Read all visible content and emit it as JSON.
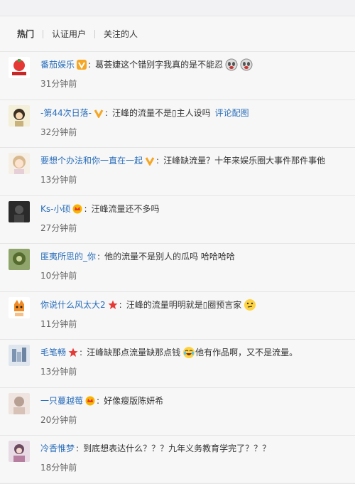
{
  "tabs": [
    {
      "label": "热门"
    },
    {
      "label": "认证用户"
    },
    {
      "label": "关注的人"
    }
  ],
  "comments": [
    {
      "user": "番茄娱乐",
      "badge": "verified-gold-icon",
      "text": "葛荟婕这个错别字我真的是不能忍",
      "emoji": "crying-face-icon",
      "time": "31分钟前"
    },
    {
      "user": "-第44次日落-",
      "badge": "verified-gold-icon",
      "text": "汪峰的流量不是▯主人设吗",
      "link": "评论配图",
      "time": "32分钟前"
    },
    {
      "user": "要想个办法和你一直在一起",
      "badge": "verified-gold-icon",
      "text": "汪峰缺流量？十年来娱乐圈大事件那件事他",
      "time": "13分钟前"
    },
    {
      "user": "Ks-小硕",
      "badge": "crown-icon",
      "text": "汪峰流量还不多吗",
      "time": "27分钟前"
    },
    {
      "user": "匪夷所思的_你",
      "text": "他的流量不是别人的瓜吗 哈哈哈哈",
      "time": "10分钟前"
    },
    {
      "user": "你说什么风太大2",
      "badge": "star-icon",
      "text": "汪峰的流量明明就是▯圈预言家",
      "emoji": "thinking-face-icon",
      "time": "11分钟前"
    },
    {
      "user": "毛笔畅",
      "badge": "star-icon",
      "text": "汪峰缺那点流量缺那点钱",
      "emoji": "laughing-face-icon",
      "text2": "他有作品啊，又不是流量。",
      "time": "13分钟前"
    },
    {
      "user": "一只蔓越莓",
      "badge": "crown-icon",
      "text": "好像瘦版陈妍希",
      "time": "20分钟前"
    },
    {
      "user": "冷香惟梦",
      "text": "到底想表达什么？？？九年义务教育学完了？？？",
      "time": "18分钟前"
    }
  ]
}
